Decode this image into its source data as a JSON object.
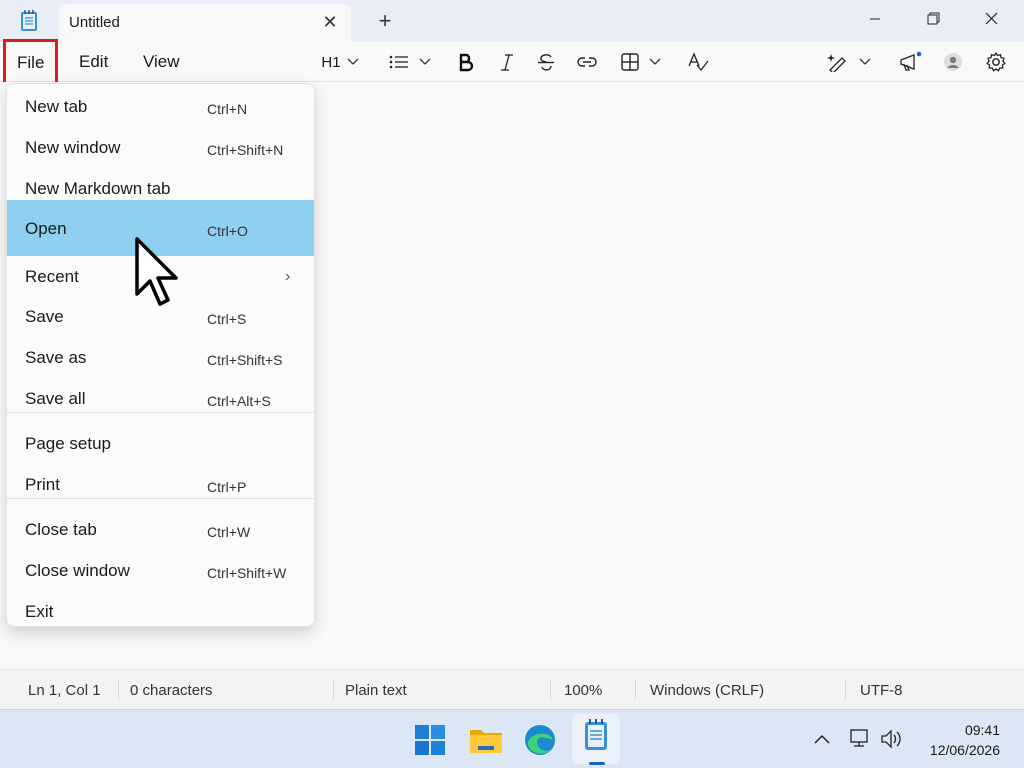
{
  "titlebar": {
    "tab_title": "Untitled",
    "tab_close": "✕",
    "new_tab": "+"
  },
  "menubar": {
    "file": "File",
    "edit": "Edit",
    "view": "View"
  },
  "toolbar": {
    "heading": "H1"
  },
  "file_menu": {
    "items": [
      {
        "label": "New tab",
        "shortcut": "Ctrl+N"
      },
      {
        "label": "New window",
        "shortcut": "Ctrl+Shift+N"
      },
      {
        "label": "New Markdown tab",
        "shortcut": ""
      },
      {
        "label": "Open",
        "shortcut": "Ctrl+O"
      },
      {
        "label": "Recent",
        "shortcut": ""
      },
      {
        "label": "Save",
        "shortcut": "Ctrl+S"
      },
      {
        "label": "Save as",
        "shortcut": "Ctrl+Shift+S"
      },
      {
        "label": "Save all",
        "shortcut": "Ctrl+Alt+S"
      },
      {
        "label": "Page setup",
        "shortcut": ""
      },
      {
        "label": "Print",
        "shortcut": "Ctrl+P"
      },
      {
        "label": "Close tab",
        "shortcut": "Ctrl+W"
      },
      {
        "label": "Close window",
        "shortcut": "Ctrl+Shift+W"
      },
      {
        "label": "Exit",
        "shortcut": ""
      }
    ],
    "recent_arrow": "›"
  },
  "statusbar": {
    "position": "Ln 1, Col 1",
    "characters": "0 characters",
    "format": "Plain text",
    "zoom": "100%",
    "line_endings": "Windows (CRLF)",
    "encoding": "UTF-8"
  },
  "taskbar": {
    "time": "09:41",
    "date": "12/06/2026"
  },
  "colors": {
    "highlight": "#8fd0f0",
    "file_outline": "#e01a1a",
    "accent": "#1a64c8"
  }
}
